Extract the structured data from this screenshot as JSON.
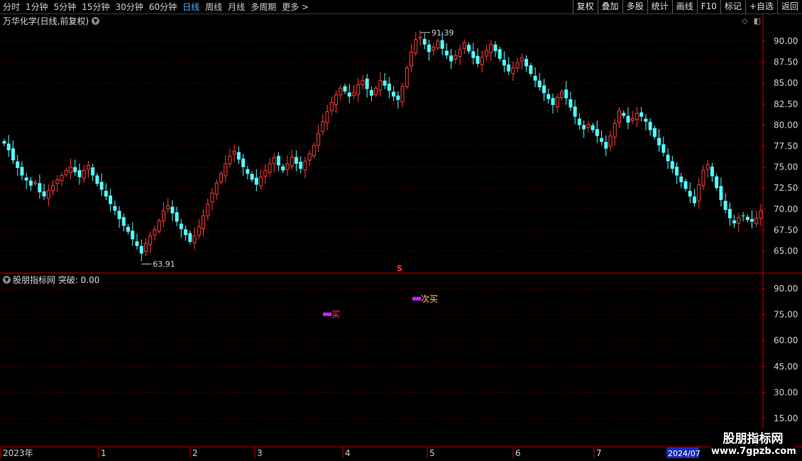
{
  "toolbar": {
    "periods": [
      {
        "label": "分时",
        "active": false
      },
      {
        "label": "1分钟",
        "active": false
      },
      {
        "label": "5分钟",
        "active": false
      },
      {
        "label": "15分钟",
        "active": false
      },
      {
        "label": "30分钟",
        "active": false
      },
      {
        "label": "60分钟",
        "active": false
      },
      {
        "label": "日线",
        "active": true
      },
      {
        "label": "周线",
        "active": false
      },
      {
        "label": "月线",
        "active": false
      },
      {
        "label": "多周期",
        "active": false
      }
    ],
    "more": "更多 >",
    "right_buttons": [
      "复权",
      "叠加",
      "多股",
      "统计",
      "画线",
      "F10",
      "标记",
      "+自选",
      "返回"
    ]
  },
  "main_title": "万华化学(日线,前复权)",
  "indicator_title": "股朋指标网 突破: 0.00",
  "price_axis": [
    "90.00",
    "87.50",
    "85.00",
    "82.50",
    "80.00",
    "77.50",
    "75.00",
    "72.50",
    "70.00",
    "67.50",
    "65.00"
  ],
  "indicator_axis": [
    "90.00",
    "75.00",
    "60.00",
    "45.00",
    "30.00",
    "15.00"
  ],
  "time_axis": [
    "2023年",
    "1",
    "2",
    "3",
    "4",
    "5",
    "6",
    "7"
  ],
  "time_axis_highlight": "2024/07",
  "high_label": "91.39",
  "low_label": "63.91",
  "s_marker": "S",
  "signals": [
    {
      "label": "买",
      "value": 75
    },
    {
      "label": "次买",
      "value": 84
    }
  ],
  "watermark": {
    "line1": "股朋指标网",
    "line2": "www.7gpzb.com"
  },
  "colors": {
    "up": "#ff3c3c",
    "down": "#54fcfc",
    "grid": "#7a0000",
    "axis": "#c80000",
    "signal": "#d020ff",
    "signal_text_up": "#ff4060",
    "signal_text_alt": "#ffcc66",
    "active": "#4fb0ff"
  },
  "chart_data": {
    "type": "candlestick",
    "title": "万华化学(日线,前复权)",
    "ylim": [
      63,
      92
    ],
    "closes": [
      77.8,
      77.0,
      75.8,
      74.9,
      74.0,
      73.4,
      72.8,
      73.2,
      72.0,
      71.5,
      72.2,
      72.8,
      73.5,
      74.0,
      74.6,
      75.0,
      74.4,
      73.8,
      74.6,
      75.2,
      74.0,
      73.0,
      72.3,
      71.5,
      70.6,
      69.8,
      68.8,
      68.0,
      67.3,
      66.4,
      65.6,
      64.7,
      65.9,
      66.8,
      67.6,
      68.6,
      69.8,
      70.4,
      69.5,
      68.5,
      67.6,
      66.9,
      66.1,
      66.8,
      67.9,
      69.2,
      70.6,
      71.9,
      73.1,
      74.2,
      75.4,
      76.3,
      76.9,
      75.9,
      75.0,
      74.2,
      73.5,
      72.9,
      73.8,
      74.6,
      75.4,
      76.1,
      75.2,
      74.6,
      75.4,
      76.2,
      75.4,
      74.8,
      75.7,
      76.6,
      77.6,
      79.0,
      80.4,
      81.6,
      82.7,
      83.6,
      84.4,
      84.0,
      83.4,
      83.9,
      84.8,
      85.3,
      84.3,
      83.5,
      84.4,
      85.3,
      84.7,
      84.1,
      83.4,
      83.0,
      84.6,
      86.8,
      88.7,
      90.2,
      90.5,
      89.6,
      88.7,
      89.3,
      90.0,
      89.1,
      88.3,
      87.6,
      88.3,
      89.0,
      89.8,
      88.8,
      88.0,
      87.3,
      88.1,
      88.9,
      89.6,
      88.8,
      87.9,
      87.1,
      86.4,
      86.8,
      87.4,
      88.0,
      87.0,
      86.1,
      85.3,
      84.5,
      83.8,
      83.1,
      82.4,
      83.3,
      84.0,
      83.2,
      82.1,
      81.0,
      80.0,
      79.5,
      80.1,
      79.4,
      78.7,
      78.0,
      77.2,
      78.7,
      80.2,
      81.7,
      81.1,
      80.3,
      80.8,
      81.4,
      81.0,
      80.4,
      79.4,
      78.6,
      77.6,
      76.7,
      75.7,
      74.8,
      74.0,
      73.2,
      72.4,
      71.5,
      70.7,
      72.9,
      74.6,
      75.3,
      73.9,
      72.5,
      71.1,
      69.9,
      68.9,
      68.3,
      69.0,
      69.2,
      68.7,
      68.5,
      68.9,
      69.8
    ]
  }
}
